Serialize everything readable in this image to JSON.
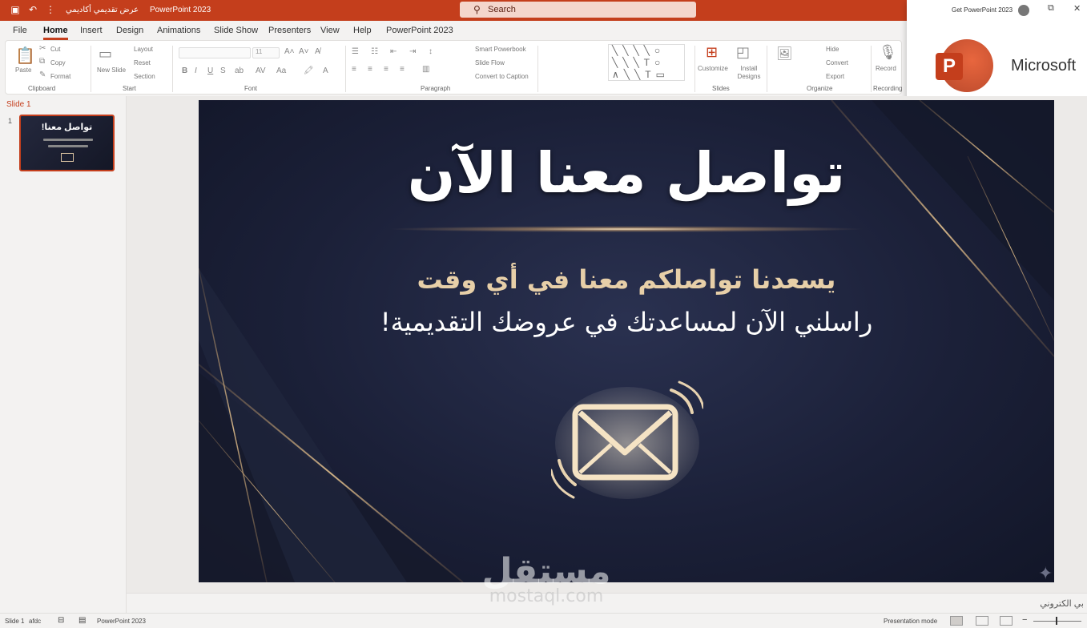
{
  "titlebar": {
    "doc_title": "عرض تقديمي أكاديمي",
    "app_title": "PowerPoint 2023",
    "search_placeholder": "Search",
    "colors": {
      "accent": "#c43e1c"
    }
  },
  "menu": {
    "tabs": [
      "File",
      "Home",
      "Insert",
      "Design",
      "Animations",
      "Slide Show",
      "Presenters",
      "View",
      "Help",
      "PowerPoint 2023"
    ],
    "active": "Home"
  },
  "ribbon": {
    "clipboard": {
      "paste": "Paste",
      "cut": "Cut",
      "copy": "Copy",
      "format": "Format",
      "label": "Clipboard"
    },
    "slides": {
      "new_slide": "New Slide",
      "layout": "Layout",
      "reset": "Reset",
      "section": "Section",
      "label": "Start"
    },
    "font": {
      "label": "Font",
      "size": "11"
    },
    "paragraph": {
      "smart": "Smart Powerbook",
      "text_dir": "Slide Flow",
      "convert": "Convert to Caption",
      "label": "Paragraph"
    },
    "drawing": {
      "label": ""
    },
    "designer": {
      "customize": "Customize",
      "designer": "Install Designs",
      "label": "Slides"
    },
    "editing": {
      "hide": "Hide",
      "convert": "Convert",
      "export": "Export",
      "label": "Organize"
    },
    "voice": {
      "record": "Record",
      "label": "Recording"
    }
  },
  "notification": {
    "header": "Get PowerPoint 2023",
    "brand": "Microsoft",
    "logo_letter": "P"
  },
  "thumbnails": {
    "section_label": "Slide 1",
    "number": "1",
    "thumb_title": "!تواصل معنا"
  },
  "slide": {
    "title": "تواصل معنا الآن",
    "subtitle1": "يسعدنا تواصلكم معنا في أي وقت",
    "subtitle2": "راسلني الآن لمساعدتك في عروضك التقديمية!",
    "icon": "envelope-icon",
    "colors": {
      "bg": "#1b2038",
      "gold": "#e7cfa8"
    }
  },
  "notes": {
    "text": "بي الكتروني"
  },
  "watermark": {
    "ar": "مستقل",
    "en": "mostaql.com"
  },
  "status": {
    "slide": "Slide 1",
    "lang": "afdc",
    "app": "PowerPoint 2023",
    "mode": "Presentation mode"
  }
}
